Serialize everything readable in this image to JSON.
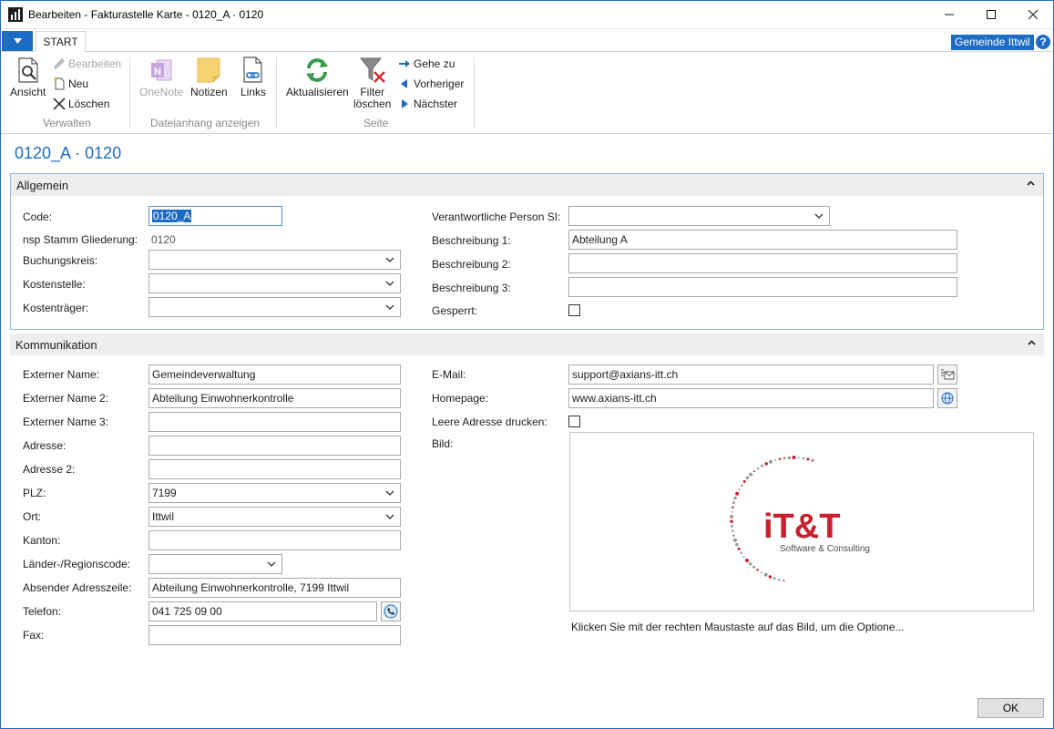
{
  "window": {
    "title": "Bearbeiten - Fakturastelle Karte - 0120_A · 0120"
  },
  "ribbon_tabs": {
    "start": "START",
    "company": "Gemeinde Ittwil",
    "help": "?"
  },
  "ribbon": {
    "verwalten": {
      "label": "Verwalten",
      "ansicht": "Ansicht",
      "bearbeiten": "Bearbeiten",
      "neu": "Neu",
      "loeschen": "Löschen"
    },
    "dateianhang": {
      "label": "Dateianhang anzeigen",
      "onenote": "OneNote",
      "notizen": "Notizen",
      "links": "Links"
    },
    "seite": {
      "label": "Seite",
      "aktualisieren": "Aktualisieren",
      "filter_1": "Filter",
      "filter_2": "löschen",
      "gehe_zu": "Gehe zu",
      "vorheriger": "Vorheriger",
      "naechster": "Nächster"
    }
  },
  "page": {
    "title": "0120_A · 0120"
  },
  "allgemein": {
    "title": "Allgemein",
    "code_label": "Code:",
    "code_value": "0120_A",
    "nsp_label": "nsp Stamm Gliederung:",
    "nsp_value": "0120",
    "buchungskreis_label": "Buchungskreis:",
    "buchungskreis_value": "",
    "kostenstelle_label": "Kostenstelle:",
    "kostenstelle_value": "",
    "kostentraeger_label": "Kostenträger:",
    "kostentraeger_value": "",
    "verantwortlich_label": "Verantwortliche Person SI:",
    "verantwortlich_value": "",
    "beschreibung1_label": "Beschreibung 1:",
    "beschreibung1_value": "Abteilung A",
    "beschreibung2_label": "Beschreibung 2:",
    "beschreibung2_value": "",
    "beschreibung3_label": "Beschreibung 3:",
    "beschreibung3_value": "",
    "gesperrt_label": "Gesperrt:",
    "gesperrt_checked": false
  },
  "kommunikation": {
    "title": "Kommunikation",
    "externer_name_label": "Externer Name:",
    "externer_name_value": "Gemeindeverwaltung",
    "externer_name2_label": "Externer Name 2:",
    "externer_name2_value": "Abteilung Einwohnerkontrolle",
    "externer_name3_label": "Externer Name 3:",
    "externer_name3_value": "",
    "adresse_label": "Adresse:",
    "adresse_value": "",
    "adresse2_label": "Adresse 2:",
    "adresse2_value": "",
    "plz_label": "PLZ:",
    "plz_value": "7199",
    "ort_label": "Ort:",
    "ort_value": "Ittwil",
    "kanton_label": "Kanton:",
    "kanton_value": "",
    "laender_label": "Länder-/Regionscode:",
    "laender_value": "",
    "absender_label": "Absender Adresszeile:",
    "absender_value": "Abteilung Einwohnerkontrolle, 7199 Ittwil",
    "telefon_label": "Telefon:",
    "telefon_value": "041 725 09 00",
    "fax_label": "Fax:",
    "fax_value": "",
    "email_label": "E-Mail:",
    "email_value": "support@axians-itt.ch",
    "homepage_label": "Homepage:",
    "homepage_value": "www.axians-itt.ch",
    "leere_adresse_label": "Leere Adresse drucken:",
    "leere_adresse_checked": false,
    "bild_label": "Bild:",
    "bild_hint": "Klicken Sie mit der rechten Maustaste auf das Bild, um die Optione...",
    "logo_main": "iT&T",
    "logo_sub": "Software & Consulting"
  },
  "footer": {
    "ok": "OK"
  },
  "colors": {
    "accent": "#1e6bc4",
    "logo_red": "#c8202f",
    "logo_gray": "#4a4a4a"
  }
}
